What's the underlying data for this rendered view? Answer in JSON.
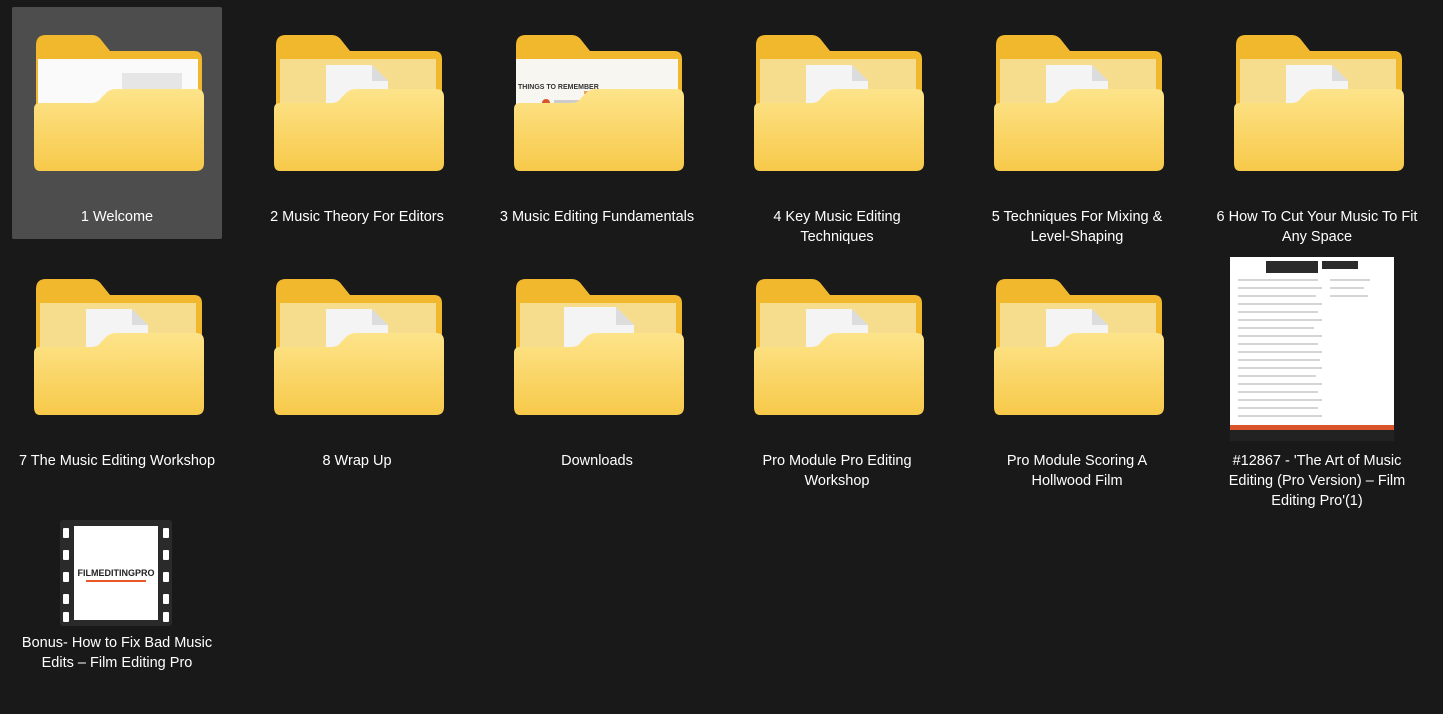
{
  "explorer": {
    "items": [
      {
        "name": "1 Welcome",
        "type": "folder",
        "preview": "blank-doc",
        "selected": true
      },
      {
        "name": "2 Music Theory For Editors",
        "type": "folder",
        "preview": "video-doc"
      },
      {
        "name": "3 Music Editing Fundamentals",
        "type": "folder",
        "preview": "slide",
        "slide_heading": "THINGS TO REMEMBER"
      },
      {
        "name": "4 Key Music Editing Techniques",
        "type": "folder",
        "preview": "video-doc"
      },
      {
        "name": "5 Techniques For Mixing & Level-Shaping",
        "type": "folder",
        "preview": "video-doc"
      },
      {
        "name": "6 How To Cut Your Music To Fit Any Space",
        "type": "folder",
        "preview": "video-doc"
      },
      {
        "name": "7 The Music Editing Workshop",
        "type": "folder",
        "preview": "video-doc"
      },
      {
        "name": "8 Wrap Up",
        "type": "folder",
        "preview": "video-doc"
      },
      {
        "name": "Downloads",
        "type": "folder",
        "preview": "pdf-doc"
      },
      {
        "name": "Pro Module Pro Editing Workshop",
        "type": "folder",
        "preview": "video-doc"
      },
      {
        "name": "Pro Module Scoring A Hollwood Film",
        "type": "folder",
        "preview": "video-doc"
      },
      {
        "name": "#12867 - 'The Art of Music Editing (Pro Version) – Film Editing Pro'(1)",
        "type": "image",
        "preview": "webpage"
      },
      {
        "name": "Bonus- How to Fix Bad Music Edits – Film Editing Pro",
        "type": "video",
        "preview": "film",
        "logo_text": "FILMEDITINGPRO"
      }
    ]
  },
  "colors": {
    "background": "#191919",
    "selection": "#4d4d4d",
    "folder_back": "#f1b82d",
    "folder_front": "#fcd86a",
    "play_ring": "#e8582a"
  }
}
